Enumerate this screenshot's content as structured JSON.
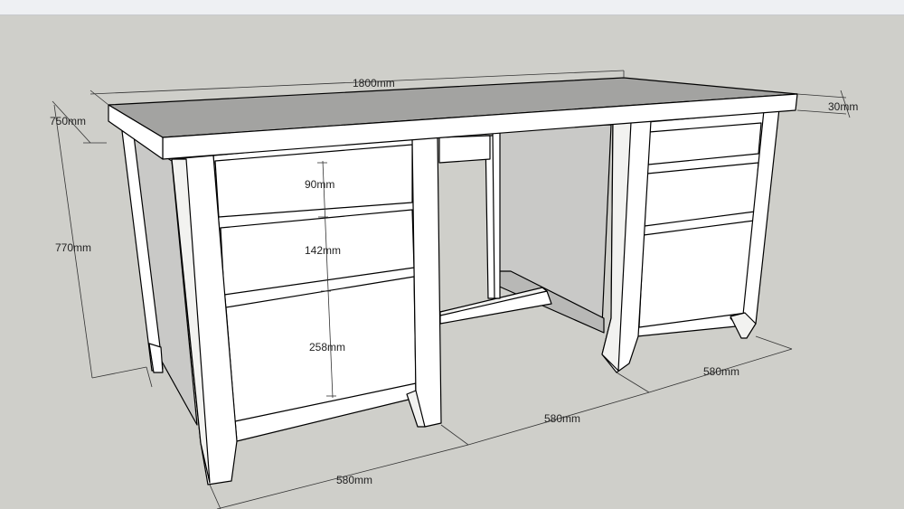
{
  "dimensions": {
    "width": "1800mm",
    "height_top": "750mm",
    "thickness": "30mm",
    "height_total": "770mm",
    "drawer_small": "90mm",
    "drawer_medium": "142mm",
    "drawer_large": "258mm",
    "depth_left_pedestal": "580mm",
    "depth_middle": "580mm",
    "depth_right_pedestal": "580mm"
  },
  "colors": {
    "background": "#cfcfca",
    "top_surface": "#a3a3a1",
    "panel_white": "#ffffff",
    "inner_shadow": "#c9c9c7"
  }
}
